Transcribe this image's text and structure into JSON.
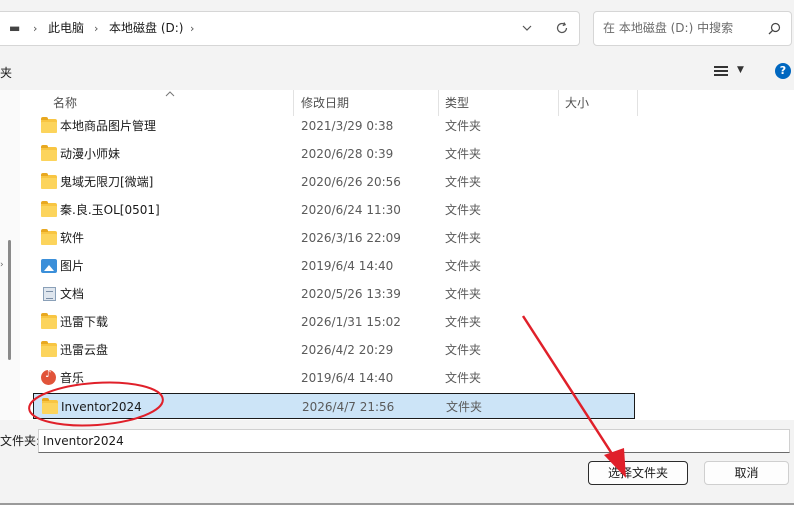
{
  "address": {
    "drive_glyph": "▬",
    "crumbs": [
      "此电脑",
      "本地磁盘 (D:)"
    ],
    "separator": "›"
  },
  "search": {
    "placeholder": "在 本地磁盘 (D:) 中搜索"
  },
  "toolbar": {
    "left_fragment": "夹",
    "help": "?"
  },
  "columns": {
    "name": "名称",
    "date": "修改日期",
    "type": "类型",
    "size": "大小"
  },
  "files": [
    {
      "name": "本地商品图片管理",
      "date": "2021/3/29 0:38",
      "type": "文件夹",
      "icon": "folder-icon"
    },
    {
      "name": "动漫小师妹",
      "date": "2020/6/28 0:39",
      "type": "文件夹",
      "icon": "folder-icon"
    },
    {
      "name": "鬼域无限刀[微端]",
      "date": "2020/6/26 20:56",
      "type": "文件夹",
      "icon": "folder-icon"
    },
    {
      "name": "秦.良.玉OL[0501]",
      "date": "2020/6/24 11:30",
      "type": "文件夹",
      "icon": "folder-icon"
    },
    {
      "name": "软件",
      "date": "2026/3/16 22:09",
      "type": "文件夹",
      "icon": "folder-icon"
    },
    {
      "name": "图片",
      "date": "2019/6/4 14:40",
      "type": "文件夹",
      "icon": "pictures-icon"
    },
    {
      "name": "文档",
      "date": "2020/5/26 13:39",
      "type": "文件夹",
      "icon": "documents-icon"
    },
    {
      "name": "迅雷下载",
      "date": "2026/1/31 15:02",
      "type": "文件夹",
      "icon": "folder-icon"
    },
    {
      "name": "迅雷云盘",
      "date": "2026/4/2 20:29",
      "type": "文件夹",
      "icon": "folder-icon"
    },
    {
      "name": "音乐",
      "date": "2019/6/4 14:40",
      "type": "文件夹",
      "icon": "music-icon"
    },
    {
      "name": "Inventor2024",
      "date": "2026/4/7 21:56",
      "type": "文件夹",
      "icon": "folder-icon",
      "selected": true
    }
  ],
  "footer": {
    "folder_label": "文件夹:",
    "folder_value": "Inventor2024",
    "select_button": "选择文件夹",
    "cancel_button": "取消"
  },
  "colors": {
    "selection": "#cce4f7",
    "annotation": "#e0202a",
    "accent": "#0067c0"
  }
}
